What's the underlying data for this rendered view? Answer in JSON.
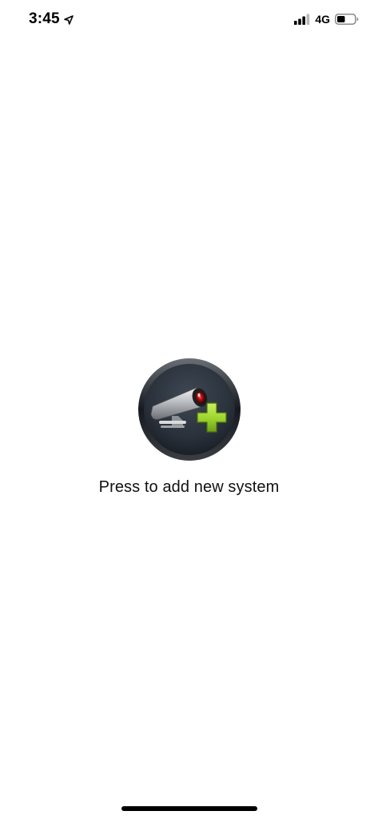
{
  "status_bar": {
    "time": "3:45",
    "network": "4G",
    "icons": {
      "location": "location-arrow-icon",
      "signal": "cellular-signal-icon",
      "battery": "battery-icon"
    },
    "battery_level": 0.45
  },
  "main": {
    "add_system_label": "Press to add new system",
    "add_system_icon": "security-camera-add-icon",
    "colors": {
      "plus": "#9bd42e",
      "disc": "#2f3742",
      "rim": "#111111"
    }
  }
}
